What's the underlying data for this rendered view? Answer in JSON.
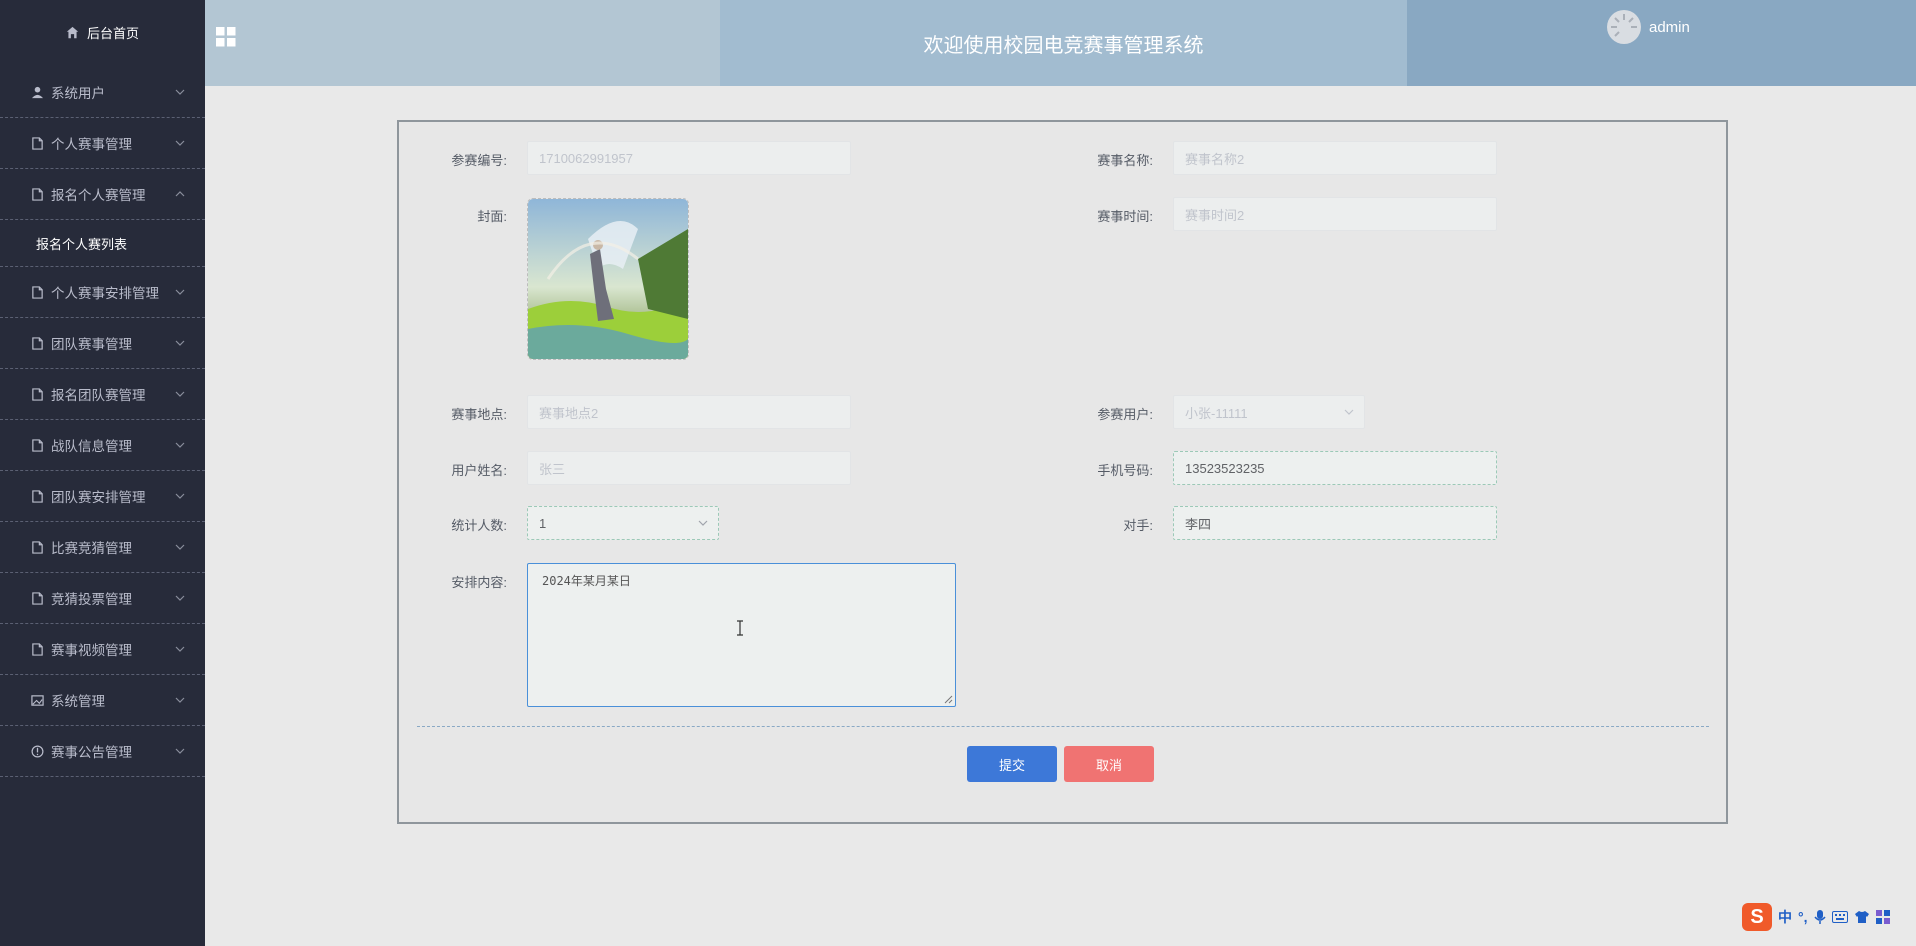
{
  "sidebar": {
    "home_label": "后台首页",
    "items": [
      {
        "label": "系统用户",
        "icon": "user-icon",
        "expanded": false
      },
      {
        "label": "个人赛事管理",
        "icon": "document-icon",
        "expanded": false
      },
      {
        "label": "报名个人赛管理",
        "icon": "document-icon",
        "expanded": true,
        "sub": [
          "报名个人赛列表"
        ]
      },
      {
        "label": "个人赛事安排管理",
        "icon": "document-icon",
        "expanded": false
      },
      {
        "label": "团队赛事管理",
        "icon": "document-icon",
        "expanded": false
      },
      {
        "label": "报名团队赛管理",
        "icon": "document-icon",
        "expanded": false
      },
      {
        "label": "战队信息管理",
        "icon": "document-icon",
        "expanded": false
      },
      {
        "label": "团队赛安排管理",
        "icon": "document-icon",
        "expanded": false
      },
      {
        "label": "比赛竞猜管理",
        "icon": "document-icon",
        "expanded": false
      },
      {
        "label": "竞猜投票管理",
        "icon": "document-icon",
        "expanded": false
      },
      {
        "label": "赛事视频管理",
        "icon": "document-icon",
        "expanded": false
      },
      {
        "label": "系统管理",
        "icon": "picture-icon",
        "expanded": false
      },
      {
        "label": "赛事公告管理",
        "icon": "info-icon",
        "expanded": false
      }
    ]
  },
  "header": {
    "title": "欢迎使用校园电竞赛事管理系统",
    "username": "admin"
  },
  "form": {
    "entry_no": {
      "label": "参赛编号:",
      "value": "1710062991957"
    },
    "event_name": {
      "label": "赛事名称:",
      "value": "赛事名称2"
    },
    "cover": {
      "label": "封面:"
    },
    "event_time": {
      "label": "赛事时间:",
      "value": "赛事时间2"
    },
    "venue": {
      "label": "赛事地点:",
      "value": "赛事地点2"
    },
    "participant": {
      "label": "参赛用户:",
      "value": "小张-11111"
    },
    "user_name": {
      "label": "用户姓名:",
      "value": "张三"
    },
    "phone": {
      "label": "手机号码:",
      "value": "13523523235"
    },
    "count": {
      "label": "统计人数:",
      "value": "1"
    },
    "opponent": {
      "label": "对手:",
      "value": "李四"
    },
    "schedule": {
      "label": "安排内容:",
      "value": "2024年某月某日"
    },
    "submit_label": "提交",
    "cancel_label": "取消"
  },
  "ime": {
    "lang": "中",
    "punct": "°,"
  },
  "colors": {
    "sidebar_bg": "#272b3a",
    "submit": "#3d78d8",
    "cancel": "#f07372"
  }
}
